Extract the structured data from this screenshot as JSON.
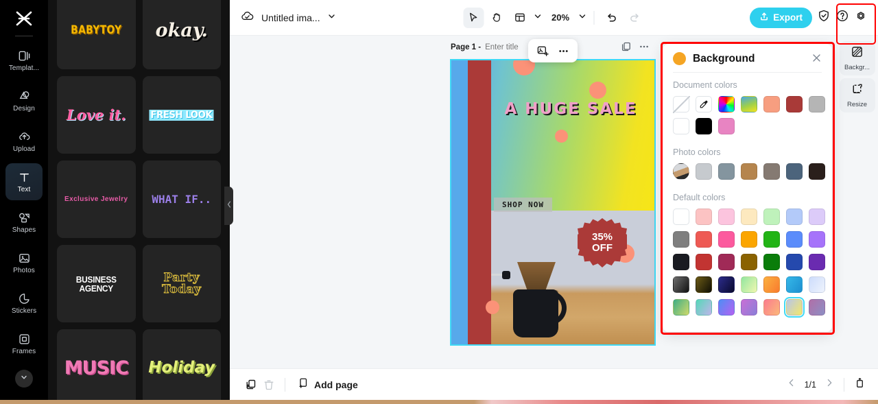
{
  "app": {
    "logo_icon": "capcut-logo-icon"
  },
  "sidebar": {
    "items": [
      {
        "label": "Templat...",
        "icon": "templates-icon",
        "active": false
      },
      {
        "label": "Design",
        "icon": "design-icon",
        "active": false
      },
      {
        "label": "Upload",
        "icon": "upload-cloud-icon",
        "active": false
      },
      {
        "label": "Text",
        "icon": "text-t-icon",
        "active": true
      },
      {
        "label": "Shapes",
        "icon": "shapes-icon",
        "active": false
      },
      {
        "label": "Photos",
        "icon": "photo-icon",
        "active": false
      },
      {
        "label": "Stickers",
        "icon": "sticker-icon",
        "active": false
      },
      {
        "label": "Frames",
        "icon": "frame-icon",
        "active": false
      }
    ],
    "more_icon": "chevron-down-icon"
  },
  "template_panel": {
    "cards": [
      {
        "text": "BABYTOY",
        "style": "t-babytoy"
      },
      {
        "text": "okay.",
        "style": "t-okay"
      },
      {
        "text": "Love it.",
        "style": "t-love"
      },
      {
        "text": "FRESH LOOK",
        "style": "t-fresh"
      },
      {
        "text": "Exclusive Jewelry",
        "style": "t-excl"
      },
      {
        "text": "WHAT IF..",
        "style": "t-whatif"
      },
      {
        "text": "BUSINESS AGENCY",
        "style": "t-biz"
      },
      {
        "text": "Party Today",
        "style": "t-party"
      },
      {
        "text": "MUSIC",
        "style": "t-music"
      },
      {
        "text": "Holiday",
        "style": "t-holiday"
      }
    ],
    "collapse_icon": "chevron-left-icon"
  },
  "toolbar": {
    "cloud_icon": "cloud-saved-icon",
    "doc_title": "Untitled ima...",
    "title_caret_icon": "chevron-down-icon",
    "select_icon": "cursor-arrow-icon",
    "hand_icon": "hand-pan-icon",
    "layout_icon": "layout-grid-icon",
    "layout_caret_icon": "chevron-down-icon",
    "zoom_level": "20%",
    "zoom_caret_icon": "chevron-down-icon",
    "undo_icon": "undo-arrow-icon",
    "redo_icon": "redo-arrow-icon",
    "export_label": "Export",
    "export_icon": "export-upload-icon",
    "export_color": "#2ed0ee",
    "shield_icon": "shield-check-icon",
    "help_icon": "question-circle-icon",
    "settings_icon": "gear-icon"
  },
  "canvas": {
    "page_label": "Page 1 -",
    "page_title_placeholder": "Enter title",
    "page_title_value": "",
    "duplicate_icon": "duplicate-page-icon",
    "page_more_icon": "more-horizontal-icon",
    "float_image_icon": "add-image-icon",
    "float_more_icon": "more-horizontal-icon",
    "selection_color": "#3fd9f5",
    "design": {
      "headline": "A  HUGE  SALE",
      "cta": "SHOP NOW",
      "badge_line1": "35%",
      "badge_line2": "OFF",
      "badge_color": "#ab3a38"
    }
  },
  "bottombar": {
    "duplicate_icon": "duplicate-page-icon",
    "delete_icon": "trash-icon",
    "add_page_label": "Add page",
    "add_page_icon": "add-page-icon",
    "prev_icon": "chevron-left-icon",
    "page_count": "1/1",
    "next_icon": "chevron-right-icon",
    "pages_icon": "page-panel-icon"
  },
  "right_rail": {
    "items": [
      {
        "label": "Backgr...",
        "icon": "background-icon",
        "active": true
      },
      {
        "label": "Resize",
        "icon": "resize-icon",
        "active": false
      }
    ],
    "highlight_color": "#ff0000"
  },
  "background_panel": {
    "title": "Background",
    "accent_dot_color": "#f5a524",
    "close_icon": "close-x-icon",
    "sections": [
      {
        "title": "Document colors",
        "swatches": [
          {
            "kind": "none",
            "name": "no-color-swatch"
          },
          {
            "kind": "picker",
            "name": "eyedropper-swatch"
          },
          {
            "kind": "color",
            "value": "conic-rainbow",
            "name": "rainbow-wheel-swatch"
          },
          {
            "kind": "color",
            "value": "linear-gradient(160deg,#4aa8e0,#9fd04a,#f2e321)"
          },
          {
            "kind": "color",
            "value": "#f79e80"
          },
          {
            "kind": "color",
            "value": "#a93a38"
          },
          {
            "kind": "color",
            "value": "#b5b5b5"
          },
          {
            "kind": "color",
            "value": "#ffffff"
          },
          {
            "kind": "color",
            "value": "#000000"
          },
          {
            "kind": "color",
            "value": "#e884c2"
          }
        ]
      },
      {
        "title": "Photo colors",
        "swatches": [
          {
            "kind": "photo",
            "name": "source-photo-swatch"
          },
          {
            "kind": "color",
            "value": "#c6cace"
          },
          {
            "kind": "color",
            "value": "#84959f"
          },
          {
            "kind": "color",
            "value": "#b5854e"
          },
          {
            "kind": "color",
            "value": "#857a72"
          },
          {
            "kind": "color",
            "value": "#4c647c"
          },
          {
            "kind": "color",
            "value": "#2a1f1b"
          }
        ]
      },
      {
        "title": "Default colors",
        "swatches": [
          {
            "kind": "color",
            "value": "#ffffff"
          },
          {
            "kind": "color",
            "value": "#fcc3c3"
          },
          {
            "kind": "color",
            "value": "#fcc4de"
          },
          {
            "kind": "color",
            "value": "#fde9bf"
          },
          {
            "kind": "color",
            "value": "#bff2bb"
          },
          {
            "kind": "color",
            "value": "#b3caf9"
          },
          {
            "kind": "color",
            "value": "#dccbf9"
          },
          {
            "kind": "color",
            "value": "#7f7f7f"
          },
          {
            "kind": "color",
            "value": "#ee5a54"
          },
          {
            "kind": "color",
            "value": "#fc5a9e"
          },
          {
            "kind": "color",
            "value": "#fba500"
          },
          {
            "kind": "color",
            "value": "#22b416"
          },
          {
            "kind": "color",
            "value": "#5b8cfb"
          },
          {
            "kind": "color",
            "value": "#a673fa"
          },
          {
            "kind": "color",
            "value": "#1a1b22"
          },
          {
            "kind": "color",
            "value": "#c23432"
          },
          {
            "kind": "color",
            "value": "#a02a57"
          },
          {
            "kind": "color",
            "value": "#8a6200"
          },
          {
            "kind": "color",
            "value": "#0a7d0a"
          },
          {
            "kind": "color",
            "value": "#2549ad"
          },
          {
            "kind": "color",
            "value": "#6a2bb0"
          },
          {
            "kind": "color",
            "value": "linear-gradient(125deg,#6e6e6e,#121212)"
          },
          {
            "kind": "color",
            "value": "linear-gradient(125deg,#6b5a16,#100f05)"
          },
          {
            "kind": "color",
            "value": "linear-gradient(125deg,#2b2b8a,#0a0a2e)"
          },
          {
            "kind": "color",
            "value": "linear-gradient(125deg,#92e6a0,#f0f7b0)"
          },
          {
            "kind": "color",
            "value": "linear-gradient(125deg,#fbb040,#f97b2e)"
          },
          {
            "kind": "color",
            "value": "linear-gradient(125deg,#35b7e8,#1d8fd0)"
          },
          {
            "kind": "color",
            "value": "linear-gradient(125deg,#cddcfb,#eef3fd)"
          },
          {
            "kind": "color",
            "value": "linear-gradient(125deg,#3fae86,#cfd96a)"
          },
          {
            "kind": "color",
            "value": "linear-gradient(125deg,#55d8b8,#c0b5ea)"
          },
          {
            "kind": "color",
            "value": "linear-gradient(125deg,#4f8df5,#b562f2)"
          },
          {
            "kind": "color",
            "value": "linear-gradient(125deg,#c96fd6,#8a7fd8)"
          },
          {
            "kind": "color",
            "value": "linear-gradient(125deg,#fb7c8e,#fbb87a)"
          },
          {
            "kind": "color",
            "value": "linear-gradient(125deg,#b9c6e8,#f3e86a)",
            "selected": true
          },
          {
            "kind": "color",
            "value": "linear-gradient(125deg,#b06fa8,#8d8fc4)"
          }
        ]
      }
    ]
  }
}
